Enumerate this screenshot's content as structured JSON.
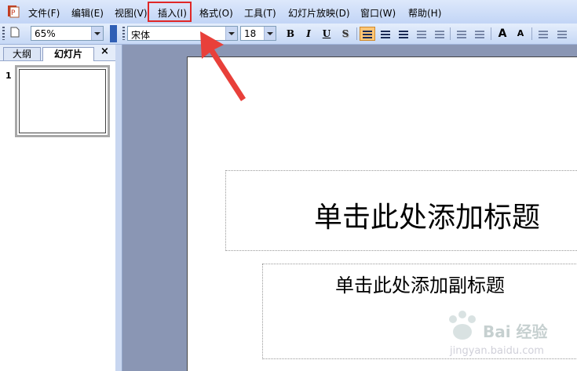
{
  "menubar": {
    "items": [
      "文件(F)",
      "编辑(E)",
      "视图(V)",
      "插入(I)",
      "格式(O)",
      "工具(T)",
      "幻灯片放映(D)",
      "窗口(W)",
      "帮助(H)"
    ]
  },
  "toolbar": {
    "zoom": "65%",
    "font": "宋体",
    "font_size": "18",
    "bold": "B",
    "italic": "I",
    "underline": "U",
    "shadow": "S",
    "grow_font": "A",
    "shrink_font": "A"
  },
  "left_pane": {
    "tab_outline": "大纲",
    "tab_slides": "幻灯片",
    "close": "×",
    "slide_number": "1"
  },
  "slide": {
    "title_placeholder": "单击此处添加标题",
    "subtitle_placeholder": "单击此处添加副标题"
  },
  "annotation": {
    "highlight_color": "#e02727",
    "arrow_color": "#e8403a"
  },
  "watermark": {
    "text": "Bai 经验",
    "sub": "jingyan.baidu.com"
  }
}
